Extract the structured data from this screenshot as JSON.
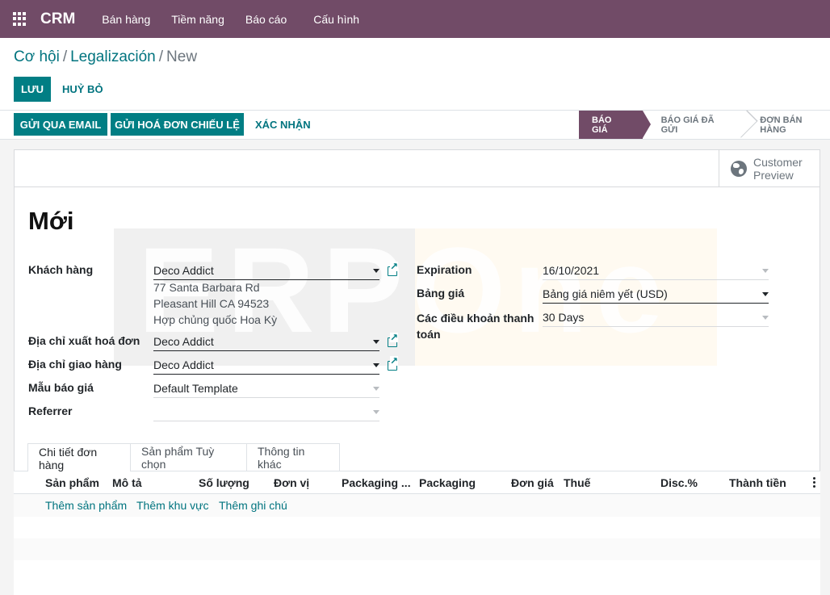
{
  "nav": {
    "brand": "CRM",
    "items": [
      "Bán hàng",
      "Tiềm năng",
      "Báo cáo",
      "Cấu hình"
    ]
  },
  "breadcrumb": {
    "crumb1": "Cơ hội",
    "crumb2": "Legalización",
    "current": "New",
    "sep": "/"
  },
  "form_actions": {
    "save": "Lưu",
    "discard": "Huỷ bỏ"
  },
  "header_buttons": {
    "send_email": "Gửi qua email",
    "send_proforma": "Gửi hoá đơn chiếu lệ",
    "confirm": "Xác nhận"
  },
  "stages": [
    "Báo giá",
    "Báo giá đã gửi",
    "Đơn bán hàng"
  ],
  "preview": {
    "line1": "Customer",
    "line2": "Preview"
  },
  "watermark": "ERPOne",
  "title": "Mới",
  "left_fields": {
    "customer_label": "Khách hàng",
    "customer_value": "Deco Addict",
    "address": [
      "77 Santa Barbara Rd",
      "Pleasant Hill CA 94523",
      "Hợp chủng quốc Hoa Kỳ"
    ],
    "invoice_label": "Địa chỉ xuất hoá đơn",
    "invoice_value": "Deco Addict",
    "shipping_label": "Địa chỉ giao hàng",
    "shipping_value": "Deco Addict",
    "template_label": "Mẫu báo giá",
    "template_value": "Default Template",
    "referrer_label": "Referrer",
    "referrer_value": ""
  },
  "right_fields": {
    "expiration_label": "Expiration",
    "expiration_value": "16/10/2021",
    "pricelist_label": "Bảng giá",
    "pricelist_value": "Bảng giá niêm yết (USD)",
    "terms_label_1": "Các điều khoản thanh",
    "terms_label_2": "toán",
    "terms_value": "30 Days"
  },
  "tabs": [
    "Chi tiết đơn hàng",
    "Sản phẩm Tuỳ chọn",
    "Thông tin khác"
  ],
  "table": {
    "columns": [
      "Sản phẩm",
      "Mô tả",
      "Số lượng",
      "Đơn vị",
      "Packaging ...",
      "Packaging",
      "Đơn giá",
      "Thuế",
      "Disc.%",
      "Thành tiền"
    ],
    "add_links": [
      "Thêm sản phẩm",
      "Thêm khu vực",
      "Thêm ghi chú"
    ]
  },
  "colors": {
    "brand": "#714B67",
    "primary": "#017E84",
    "link": "#01747F"
  }
}
